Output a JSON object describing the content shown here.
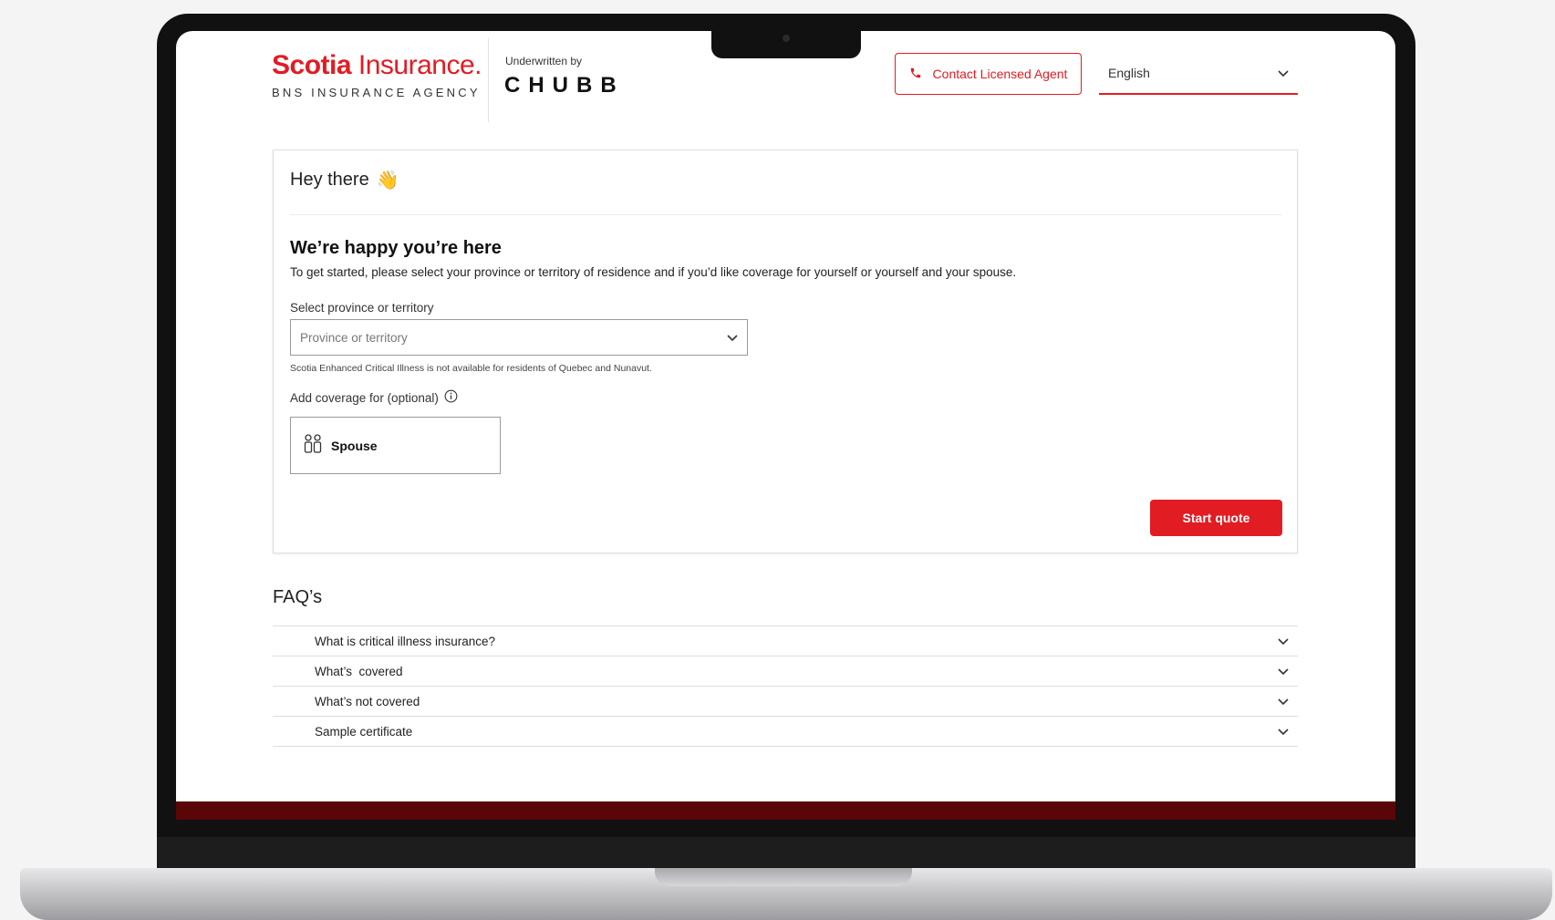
{
  "header": {
    "logo_brand": "Scotia",
    "logo_product": "Insurance.",
    "logo_sub": "BNS INSURANCE AGENCY",
    "underwritten_by": "Underwritten by",
    "underwriter_logo": "CHUBB",
    "contact_button": "Contact Licensed Agent",
    "language": "English"
  },
  "card": {
    "greeting": "Hey there",
    "greeting_emoji": "👋",
    "headline": "We’re happy you’re here",
    "intro": "To get started, please select your province or territory of residence and if you’d like coverage for yourself or yourself and your spouse.",
    "province_label": "Select province or territory",
    "province_placeholder": "Province or territory",
    "province_note": "Scotia Enhanced Critical Illness is not available for residents of Quebec and Nunavut.",
    "coverage_label": "Add coverage for (optional)",
    "spouse_option": "Spouse",
    "start_button": "Start quote"
  },
  "faq": {
    "title": "FAQ’s",
    "items": [
      {
        "label": "What is critical illness insurance?"
      },
      {
        "label": "What’s  covered"
      },
      {
        "label": "What’s not covered"
      },
      {
        "label": "Sample certificate"
      }
    ]
  },
  "colors": {
    "brand_red": "#e21c23",
    "footer_dark_red": "#5a0508"
  },
  "icons": {
    "contact": "phone-icon",
    "language": "chevron-down-icon",
    "province": "chevron-down-icon",
    "coverage_info": "info-icon",
    "spouse": "people-icon",
    "faq": "chevron-down-icon"
  }
}
